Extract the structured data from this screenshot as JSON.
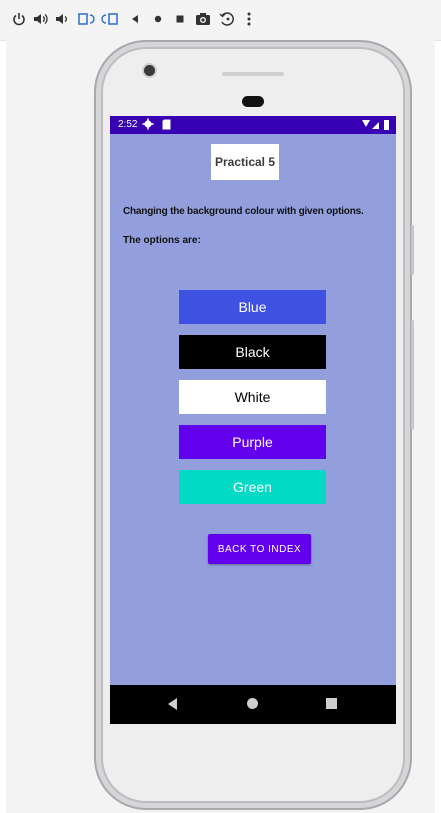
{
  "toolbar": {
    "icons": [
      "power-icon",
      "volume-up-icon",
      "volume-down-icon",
      "rotate-left-icon",
      "rotate-right-icon",
      "back-icon",
      "home-icon",
      "overview-icon",
      "screenshot-icon",
      "zoom-icon",
      "more-icon"
    ]
  },
  "status_bar": {
    "time": "2:52"
  },
  "app": {
    "title": "Practical 5",
    "description": "Changing the background colour with given options.",
    "options_label": "The options are:",
    "buttons": [
      {
        "label": "Blue",
        "bg": "#3f51e0",
        "fg": "#ffffff"
      },
      {
        "label": "Black",
        "bg": "#000000",
        "fg": "#ffffff"
      },
      {
        "label": "White",
        "bg": "#ffffff",
        "fg": "#000000"
      },
      {
        "label": "Purple",
        "bg": "#6200ee",
        "fg": "#ffffff"
      },
      {
        "label": "Green",
        "bg": "#03dac5",
        "fg": "#ffffff"
      }
    ],
    "back_button": "BACK TO INDEX"
  },
  "colors": {
    "screen_bg": "#939fdd",
    "status_bar": "#3700b3",
    "nav_bar": "#000000"
  }
}
